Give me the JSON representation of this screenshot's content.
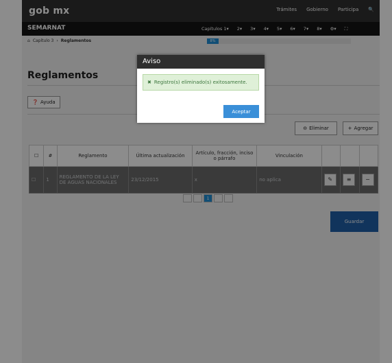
{
  "header": {
    "logo": "gob mx",
    "links": [
      "Trámites",
      "Gobierno",
      "Participa"
    ],
    "search_icon": "search-icon"
  },
  "navbar": {
    "brand": "SEMARNAT",
    "chapters": [
      "Capítulos 1",
      "2",
      "3",
      "4",
      "5",
      "6",
      "7",
      "8"
    ]
  },
  "breadcrumb": {
    "home_icon": "home-icon",
    "items": [
      "Capítulo 3",
      "Reglamentos"
    ]
  },
  "progress": {
    "label": "8%",
    "value": 8
  },
  "page": {
    "title": "Reglamentos",
    "help_button": "Ayuda",
    "delete_button": "Eliminar",
    "add_button": "Agregar",
    "save_button": "Guardar"
  },
  "table": {
    "headers": [
      "#",
      "Reglamento",
      "Última actualización",
      "Artículo, fracción, inciso o párrafo",
      "Vinculación"
    ],
    "rows": [
      {
        "num": "1",
        "reglamento": "REGLAMENTO DE LA LEY DE AGUAS NACIONALES",
        "fecha": "23/12/2015",
        "articulo": "x",
        "vinculacion": "no aplica"
      }
    ]
  },
  "pager": {
    "current": "1"
  },
  "modal": {
    "title": "Aviso",
    "message": "Registro(s) eliminado(s) exitosamente.",
    "ok_button": "Aceptar"
  },
  "colors": {
    "success_bg": "#dff0d8",
    "primary": "#3a8fd8"
  }
}
